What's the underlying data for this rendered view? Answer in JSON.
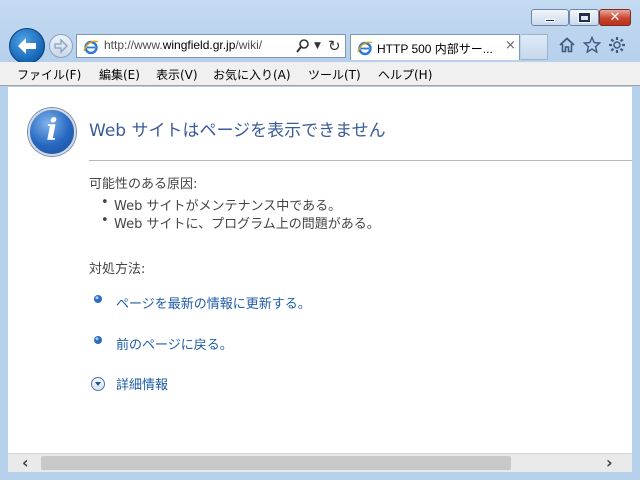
{
  "window": {
    "minimize_icon": "minimize-icon",
    "maximize_icon": "maximize-icon",
    "close_glyph": "✕"
  },
  "nav": {
    "back_icon": "back-arrow-icon",
    "forward_icon": "forward-arrow-icon"
  },
  "address": {
    "url_prefix": "http://www.",
    "url_domain": "wingfield.gr.jp",
    "url_suffix": "/wiki/",
    "search_icon": "search-icon",
    "refresh_icon": "refresh-icon"
  },
  "tab": {
    "title": "HTTP 500 内部サー...",
    "close_glyph": "×"
  },
  "toolbar": {
    "home_icon": "home-icon",
    "favorites_icon": "star-icon",
    "settings_icon": "gear-icon"
  },
  "menu": [
    {
      "label": "ファイル(F)"
    },
    {
      "label": "編集(E)"
    },
    {
      "label": "表示(V)"
    },
    {
      "label": "お気に入り(A)"
    },
    {
      "label": "ツール(T)"
    },
    {
      "label": "ヘルプ(H)"
    }
  ],
  "page": {
    "heading": "Web サイトはページを表示できません",
    "causes_label": "可能性のある原因:",
    "causes": [
      "Web サイトがメンテナンス中である。",
      "Web サイトに、プログラム上の問題がある。"
    ],
    "actions_label": "対処方法:",
    "actions": [
      "ページを最新の情報に更新する。",
      "前のページに戻る。"
    ],
    "more_info": "詳細情報"
  },
  "colors": {
    "link": "#1f5ca8",
    "heading": "#3a5b9a",
    "text": "#444444"
  }
}
